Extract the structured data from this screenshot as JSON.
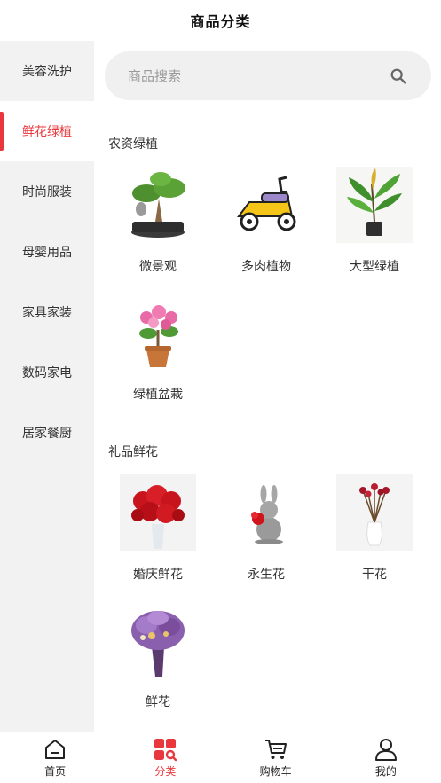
{
  "header": {
    "title": "商品分类"
  },
  "sidebar": {
    "items": [
      {
        "label": "美容洗护",
        "active": false
      },
      {
        "label": "鲜花绿植",
        "active": true
      },
      {
        "label": "时尚服装",
        "active": false
      },
      {
        "label": "母婴用品",
        "active": false
      },
      {
        "label": "家具家装",
        "active": false
      },
      {
        "label": "数码家电",
        "active": false
      },
      {
        "label": "居家餐厨",
        "active": false
      }
    ]
  },
  "search": {
    "placeholder": "商品搜索",
    "icon": "search-icon"
  },
  "sections": [
    {
      "title": "农资绿植",
      "items": [
        {
          "label": "微景观",
          "icon": "bonsai-image"
        },
        {
          "label": "多肉植物",
          "icon": "scooter-image"
        },
        {
          "label": "大型绿植",
          "icon": "potted-plant-image"
        },
        {
          "label": "绿植盆栽",
          "icon": "flowering-pot-image"
        }
      ]
    },
    {
      "title": "礼品鲜花",
      "items": [
        {
          "label": "婚庆鲜花",
          "icon": "rose-bouquet-image"
        },
        {
          "label": "永生花",
          "icon": "rabbit-rose-image"
        },
        {
          "label": "干花",
          "icon": "dried-flowers-image"
        },
        {
          "label": "鲜花",
          "icon": "lavender-bouquet-image"
        }
      ]
    }
  ],
  "tabbar": {
    "tabs": [
      {
        "label": "首页",
        "icon": "home-icon",
        "active": false
      },
      {
        "label": "分类",
        "icon": "category-icon",
        "active": true
      },
      {
        "label": "购物车",
        "icon": "cart-icon",
        "active": false
      },
      {
        "label": "我的",
        "icon": "user-icon",
        "active": false
      }
    ]
  },
  "colors": {
    "accent": "#e8383d",
    "sidebar_bg": "#f2f2f2",
    "search_bg": "#f0f0f0"
  }
}
